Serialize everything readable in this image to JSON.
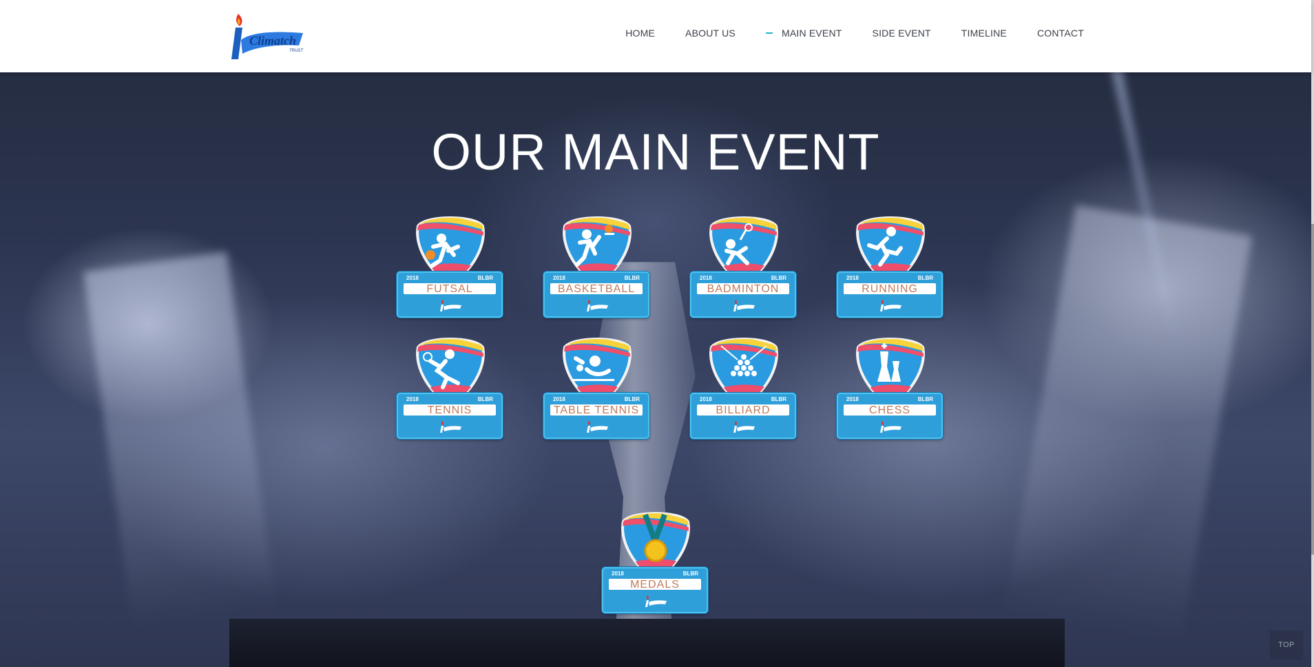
{
  "colors": {
    "accent": "#24b4c9",
    "nav_text": "#3a3f48",
    "plate_blue": "#2f9fd9"
  },
  "header": {
    "logo_icon": "iclimatch-torch-logo-icon",
    "nav": [
      {
        "label": "HOME",
        "active": false
      },
      {
        "label": "ABOUT US",
        "active": false
      },
      {
        "label": "MAIN EVENT",
        "active": true
      },
      {
        "label": "SIDE EVENT",
        "active": false
      },
      {
        "label": "TIMELINE",
        "active": false
      },
      {
        "label": "CONTACT",
        "active": false
      }
    ]
  },
  "main": {
    "title": "OUR MAIN EVENT",
    "badges": [
      {
        "label": "FUTSAL",
        "year": "2018",
        "code": "BLBR",
        "icon": "futsal-icon"
      },
      {
        "label": "BASKETBALL",
        "year": "2018",
        "code": "BLBR",
        "icon": "basketball-icon"
      },
      {
        "label": "BADMINTON",
        "year": "2018",
        "code": "BLBR",
        "icon": "badminton-icon"
      },
      {
        "label": "RUNNING",
        "year": "2018",
        "code": "BLBR",
        "icon": "running-icon"
      },
      {
        "label": "TENNIS",
        "year": "2018",
        "code": "BLBR",
        "icon": "tennis-icon"
      },
      {
        "label": "TABLE TENNIS",
        "year": "2018",
        "code": "BLBR",
        "icon": "table-tennis-icon"
      },
      {
        "label": "BILLIARD",
        "year": "2018",
        "code": "BLBR",
        "icon": "billiard-icon"
      },
      {
        "label": "CHESS",
        "year": "2018",
        "code": "BLBR",
        "icon": "chess-icon"
      },
      {
        "label": "MEDALS",
        "year": "2018",
        "code": "BLBR",
        "icon": "medal-icon"
      }
    ]
  },
  "scroll_top_label": "TOP"
}
